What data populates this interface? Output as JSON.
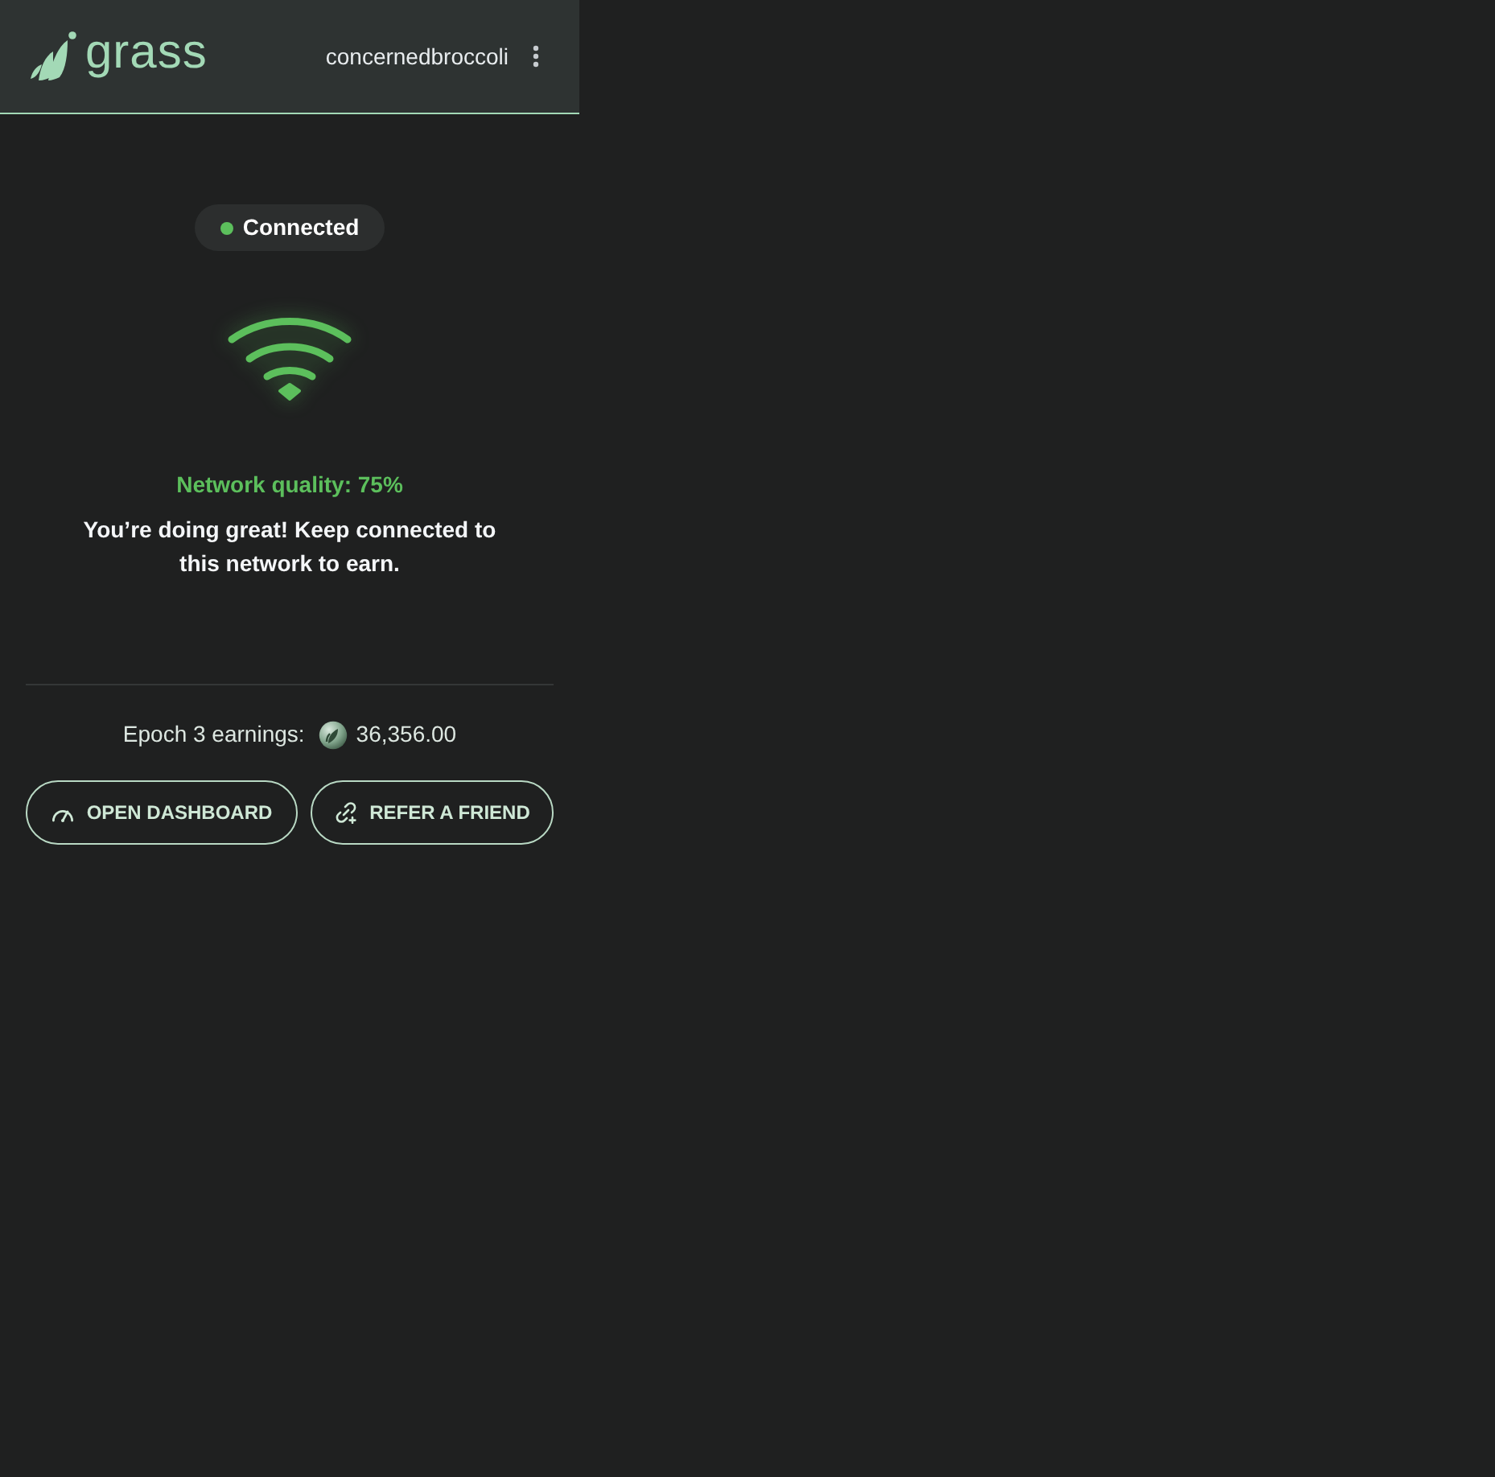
{
  "header": {
    "logo": "grass",
    "username": "concernedbroccoli"
  },
  "status": {
    "label": "Connected",
    "connected": true
  },
  "network": {
    "quality": "Network quality: 75%",
    "message": "You’re doing great! Keep connected to this network to earn."
  },
  "earnings": {
    "label": "Epoch 3 earnings:",
    "amount": "36,356.00"
  },
  "buttons": [
    {
      "label": "OPEN DASHBOARD",
      "kind": "dashboard"
    },
    {
      "label": "REFER A FRIEND",
      "kind": "refer"
    }
  ]
}
